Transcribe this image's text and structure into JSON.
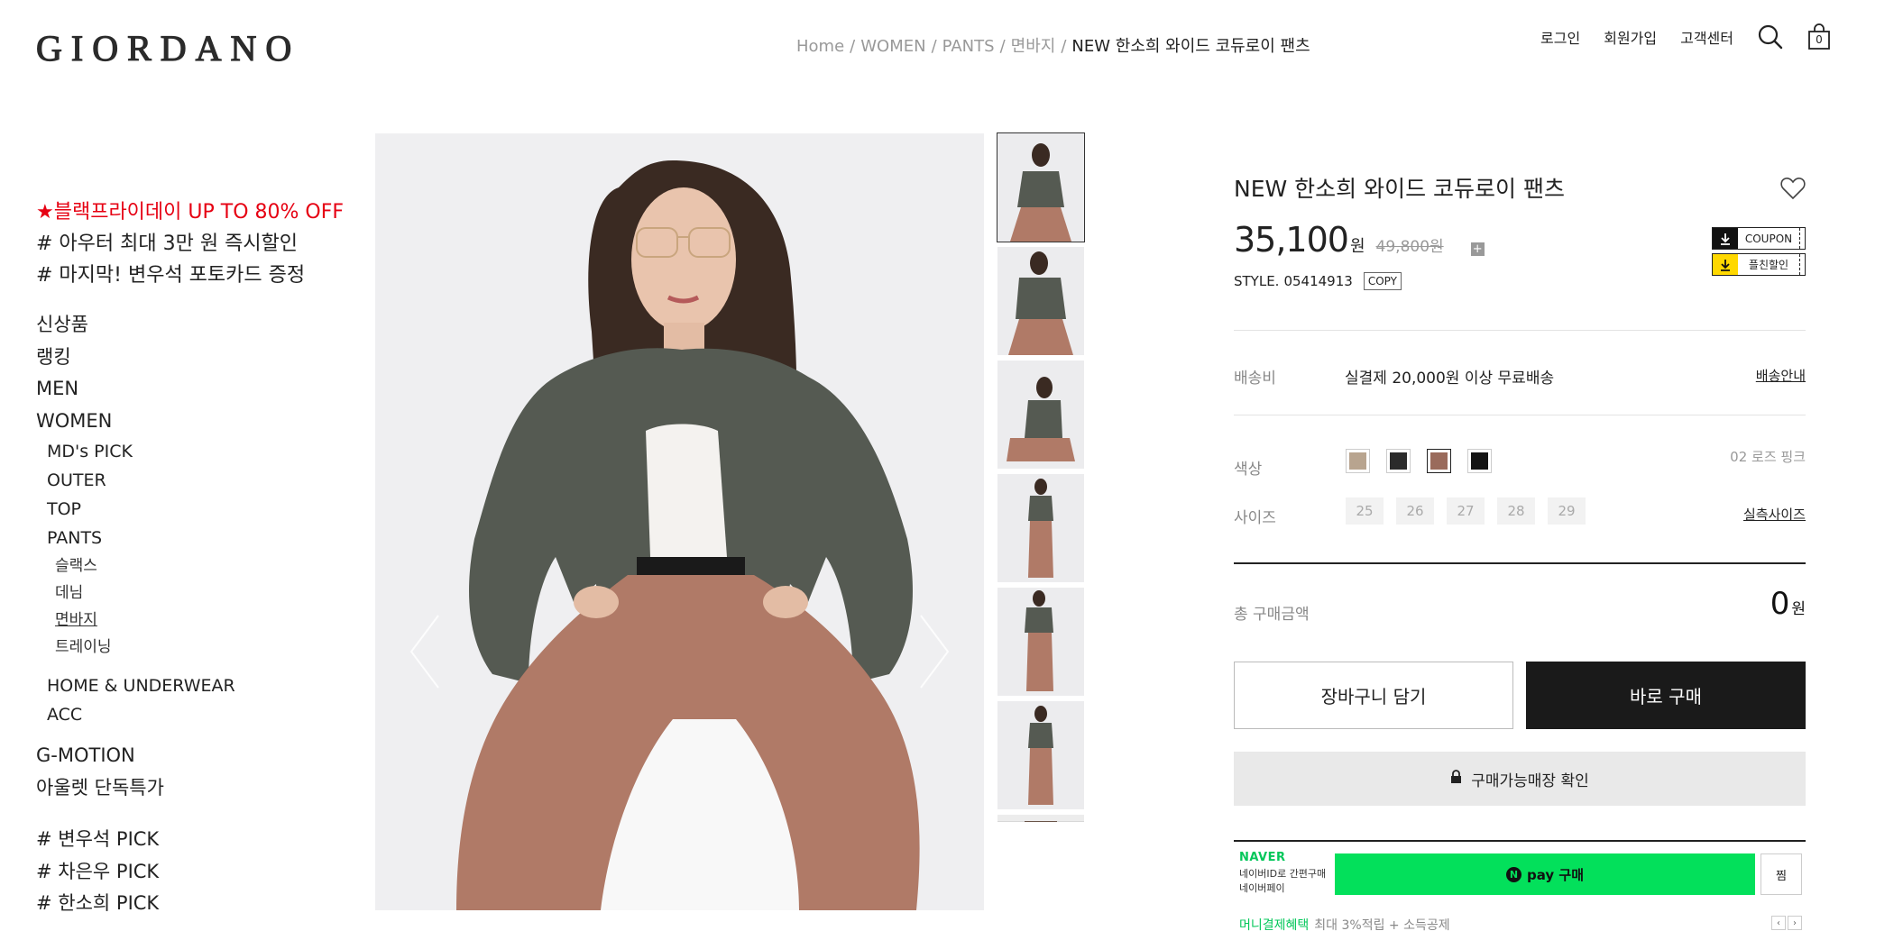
{
  "header": {
    "logo": "GIORDANO",
    "breadcrumb": [
      "Home",
      "WOMEN",
      "PANTS",
      "면바지",
      "NEW 한소희 와이드 코듀로이 팬츠"
    ],
    "breadcrumb_sep": "/",
    "links": {
      "login": "로그인",
      "signup": "회원가입",
      "support": "고객센터"
    },
    "cart_count": "0"
  },
  "sidebar": {
    "promos": [
      "★블랙프라이데이 UP TO 80% OFF",
      "# 아우터 최대 3만 원 즉시할인",
      "# 마지막! 변우석 포토카드 증정"
    ],
    "top_items": [
      "신상품",
      "랭킹",
      "MEN",
      "WOMEN"
    ],
    "women_items": [
      "MD's PICK",
      "OUTER",
      "TOP",
      "PANTS"
    ],
    "pants_items": [
      "슬랙스",
      "데님",
      "면바지",
      "트레이닝"
    ],
    "more_items": [
      "HOME & UNDERWEAR",
      "ACC"
    ],
    "special_items": [
      "G-MOTION",
      "아울렛 단독특가"
    ],
    "pick_items": [
      "# 변우석 PICK",
      "# 차은우 PICK",
      "# 한소희 PICK"
    ]
  },
  "product": {
    "title": "NEW 한소희 와이드 코듀로이 팬츠",
    "price": "35,100",
    "currency": "원",
    "original_price": "49,800원",
    "style_label": "STYLE.",
    "style_code": "05414913",
    "copy_label": "COPY",
    "coupons": [
      "COUPON",
      "플친할인"
    ],
    "shipping_label": "배송비",
    "shipping_text": "실결제 20,000원 이상 무료배송",
    "shipping_link": "배송안내",
    "color_label": "색상",
    "colors": [
      "#b8a48f",
      "#2b2b2b",
      "#9a6b5c",
      "#141414"
    ],
    "selected_color_name": "02 로즈 핑크",
    "size_label": "사이즈",
    "sizes": [
      "25",
      "26",
      "27",
      "28",
      "29"
    ],
    "size_link": "실측사이즈",
    "total_label": "총 구매금액",
    "total_value": "0",
    "add_to_cart": "장바구니 담기",
    "buy_now": "바로 구매",
    "store_check": "구매가능매장 확인",
    "naver_logo": "NAVER",
    "naver_desc_1": "네이버ID로 간편구매",
    "naver_desc_2": "네이버페이",
    "npay_label": "pay 구매",
    "npay_n": "N",
    "jjim": "찜",
    "npay_benefit_label": "머니결제혜택",
    "npay_benefit_text": "최대 3%적립 + 소득공제"
  },
  "colors": {
    "accent_red": "#e60012",
    "buy_dark": "#1a1a1a",
    "npay_green": "#03e05b"
  }
}
